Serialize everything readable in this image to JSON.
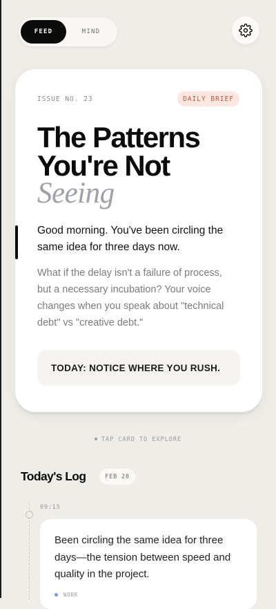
{
  "nav": {
    "tabs": [
      {
        "label": "FEED",
        "active": true
      },
      {
        "label": "MIND",
        "active": false
      }
    ],
    "settings_icon": "gear-icon"
  },
  "card": {
    "issue": "ISSUE NO. 23",
    "badge": "DAILY BRIEF",
    "headline_line1": "The Patterns",
    "headline_line2": "You're Not",
    "headline_italic": "Seeing",
    "greeting": "Good morning. You've been circling the same idea for three days now.",
    "body": "What if the delay isn't a failure of process, but a necessary incubation? Your voice changes when you speak about \"technical debt\" vs \"creative debt.\"",
    "action": "TODAY: NOTICE WHERE YOU RUSH."
  },
  "hint": "TAP CARD TO EXPLORE",
  "log": {
    "title": "Today's Log",
    "date": "FEB 28",
    "entries": [
      {
        "time": "09:15",
        "text": "Been circling the same idea for three days—the tension between speed and quality in the project.",
        "tag": "WORK"
      }
    ]
  },
  "colors": {
    "background": "#efede8",
    "card": "#ffffff",
    "badge_bg": "#fbe6e0",
    "badge_text": "#c2553d",
    "italic_accent": "#9ea0aa",
    "tag_work": "#7a9ae0"
  }
}
